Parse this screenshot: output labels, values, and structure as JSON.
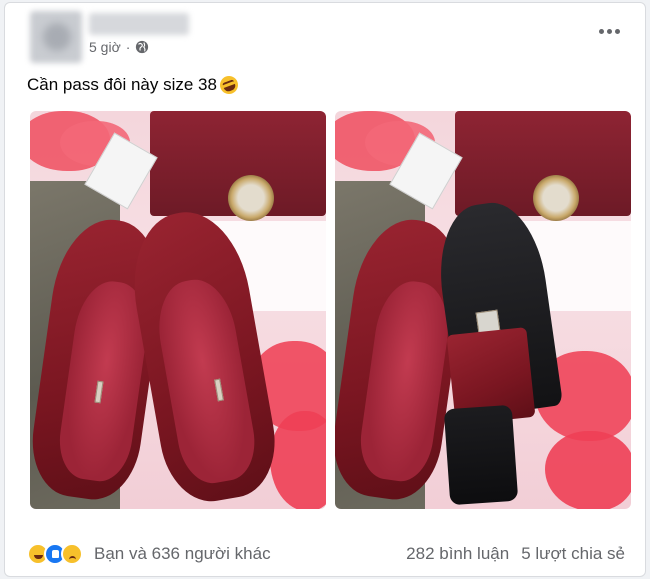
{
  "post": {
    "time": "5 giờ",
    "privacy_icon": "globe-icon",
    "text": "Cần pass đôi này size 38",
    "emoji": "rolling-on-floor-laughing-emoji"
  },
  "photos": [
    {
      "subject": "red-pointed-heels-insoles"
    },
    {
      "subject": "red-pointed-heels-sole"
    }
  ],
  "footer": {
    "reaction_icons": [
      "haha-icon",
      "like-icon",
      "sad-icon"
    ],
    "reactions_text": "Bạn và 636 người khác",
    "comments": "282 bình luận",
    "shares": "5 lượt chia sẻ"
  },
  "colors": {
    "accent": "#1877f2",
    "secondary_text": "#65676b",
    "background": "#f0f2f5"
  }
}
